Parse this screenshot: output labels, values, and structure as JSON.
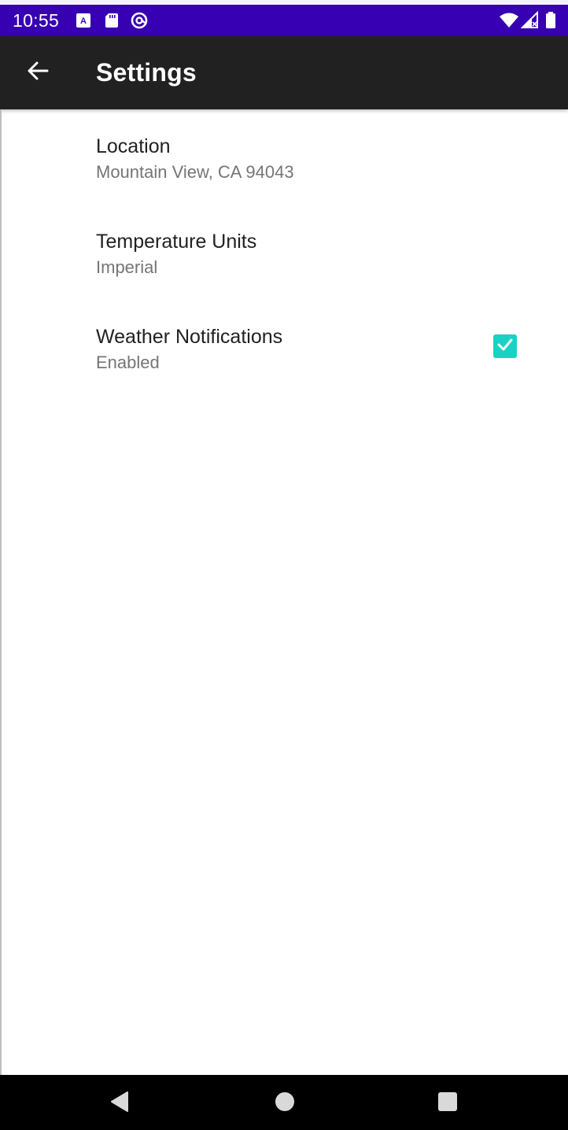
{
  "status_bar": {
    "time": "10:55",
    "icons_left": [
      "keyboard-a-icon",
      "sd-card-icon",
      "at-sync-icon"
    ],
    "icons_right": [
      "wifi-icon",
      "signal-icon",
      "battery-icon"
    ],
    "color": "#3700b3"
  },
  "app_bar": {
    "title": "Settings",
    "back_icon": "arrow-back-icon",
    "color": "#212121"
  },
  "preferences": [
    {
      "title": "Location",
      "summary": "Mountain View, CA 94043"
    },
    {
      "title": "Temperature Units",
      "summary": "Imperial"
    },
    {
      "title": "Weather Notifications",
      "summary": "Enabled",
      "checked": true
    }
  ],
  "accent_color": "#18d2c4",
  "nav_bar": {
    "buttons": [
      "back-triangle-icon",
      "home-circle-icon",
      "recents-square-icon"
    ]
  }
}
